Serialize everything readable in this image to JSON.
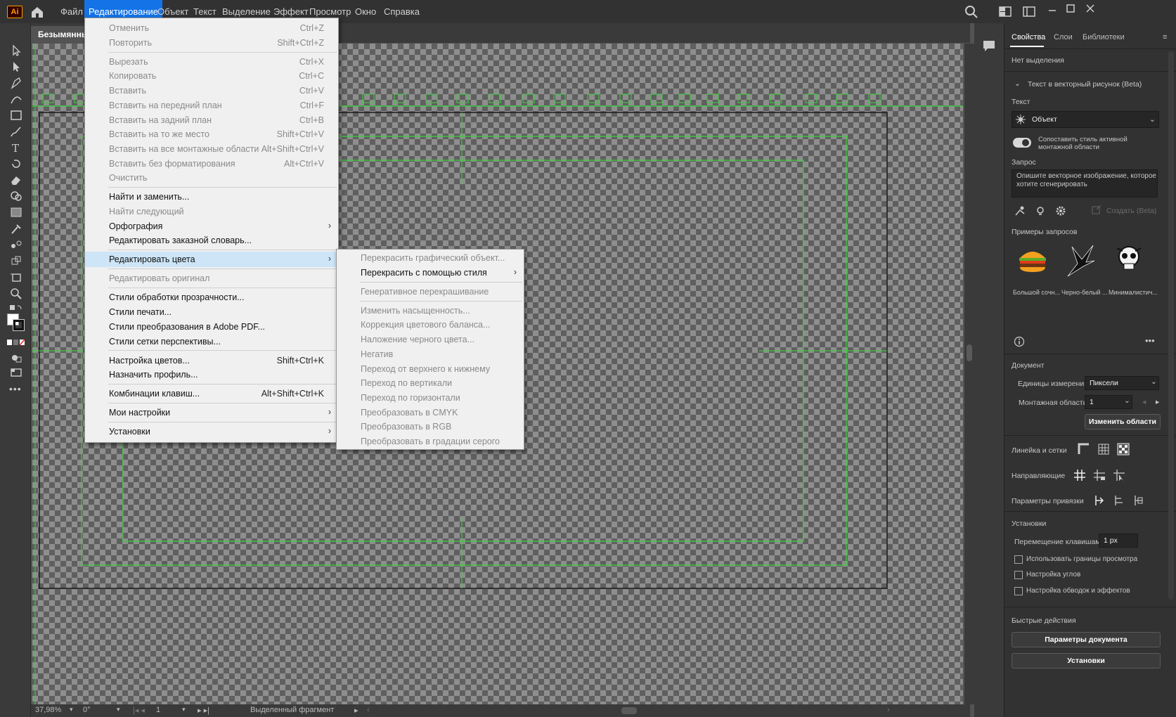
{
  "app": {
    "logo": "Ai",
    "doc_tab": "Безымянный"
  },
  "menubar": [
    "Файл",
    "Редактирование",
    "Объект",
    "Текст",
    "Выделение",
    "Эффект",
    "Просмотр",
    "Окно",
    "Справка"
  ],
  "edit_menu": [
    {
      "label": "Отменить",
      "shortcut": "Ctrl+Z",
      "disabled": true
    },
    {
      "label": "Повторить",
      "shortcut": "Shift+Ctrl+Z",
      "disabled": true
    },
    {
      "sep": true
    },
    {
      "label": "Вырезать",
      "shortcut": "Ctrl+X",
      "disabled": true
    },
    {
      "label": "Копировать",
      "shortcut": "Ctrl+C",
      "disabled": true
    },
    {
      "label": "Вставить",
      "shortcut": "Ctrl+V",
      "disabled": true
    },
    {
      "label": "Вставить на передний план",
      "shortcut": "Ctrl+F",
      "disabled": true
    },
    {
      "label": "Вставить на задний план",
      "shortcut": "Ctrl+B",
      "disabled": true
    },
    {
      "label": "Вставить на то же место",
      "shortcut": "Shift+Ctrl+V",
      "disabled": true
    },
    {
      "label": "Вставить на все монтажные области",
      "shortcut": "Alt+Shift+Ctrl+V",
      "disabled": true
    },
    {
      "label": "Вставить без форматирования",
      "shortcut": "Alt+Ctrl+V",
      "disabled": true
    },
    {
      "label": "Очистить",
      "shortcut": "",
      "disabled": true
    },
    {
      "sep": true
    },
    {
      "label": "Найти и заменить...",
      "shortcut": ""
    },
    {
      "label": "Найти следующий",
      "shortcut": "",
      "disabled": true
    },
    {
      "label": "Орфография",
      "shortcut": "",
      "submenu": true
    },
    {
      "label": "Редактировать заказной словарь...",
      "shortcut": ""
    },
    {
      "sep": true
    },
    {
      "label": "Редактировать цвета",
      "shortcut": "",
      "submenu": true,
      "highlight": true
    },
    {
      "sep": true
    },
    {
      "label": "Редактировать оригинал",
      "shortcut": "",
      "disabled": true
    },
    {
      "sep": true
    },
    {
      "label": "Стили обработки прозрачности...",
      "shortcut": ""
    },
    {
      "label": "Стили печати...",
      "shortcut": ""
    },
    {
      "label": "Стили преобразования в Adobe PDF...",
      "shortcut": ""
    },
    {
      "label": "Стили сетки перспективы...",
      "shortcut": ""
    },
    {
      "sep": true
    },
    {
      "label": "Настройка цветов...",
      "shortcut": "Shift+Ctrl+K"
    },
    {
      "label": "Назначить профиль...",
      "shortcut": ""
    },
    {
      "sep": true
    },
    {
      "label": "Комбинации клавиш...",
      "shortcut": "Alt+Shift+Ctrl+K"
    },
    {
      "sep": true
    },
    {
      "label": "Мои настройки",
      "shortcut": "",
      "submenu": true
    },
    {
      "sep": true
    },
    {
      "label": "Установки",
      "shortcut": "",
      "submenu": true
    }
  ],
  "colors_submenu": [
    {
      "label": "Перекрасить графический объект...",
      "disabled": true
    },
    {
      "label": "Перекрасить с помощью стиля",
      "submenu": true
    },
    {
      "sep": true
    },
    {
      "label": "Генеративное перекрашивание",
      "disabled": true
    },
    {
      "sep": true
    },
    {
      "label": "Изменить насыщенность...",
      "disabled": true
    },
    {
      "label": "Коррекция цветового баланса...",
      "disabled": true
    },
    {
      "label": "Наложение черного цвета...",
      "disabled": true
    },
    {
      "label": "Негатив",
      "disabled": true
    },
    {
      "label": "Переход от верхнего к нижнему",
      "disabled": true
    },
    {
      "label": "Переход по вертикали",
      "disabled": true
    },
    {
      "label": "Переход по горизонтали",
      "disabled": true
    },
    {
      "label": "Преобразовать в CMYK",
      "disabled": true
    },
    {
      "label": "Преобразовать в RGB",
      "disabled": true
    },
    {
      "label": "Преобразовать в градации серого",
      "disabled": true
    }
  ],
  "status": {
    "zoom": "37,98%",
    "rotation": "0°",
    "artboard": "1",
    "mode": "Выделенный фрагмент"
  },
  "panel": {
    "tabs": [
      "Свойства",
      "Слои",
      "Библиотеки"
    ],
    "no_selection": "Нет выделения",
    "section_t2v": "Текст в векторный рисунок (Beta)",
    "type_label": "Текст",
    "type_value": "Объект",
    "match_style": "Сопоставить стиль активной монтажной области",
    "prompt_label": "Запрос",
    "prompt_placeholder": "Опишите векторное изображение, которое хотите сгенерировать",
    "generate_btn": "Создать (Beta)",
    "examples_label": "Примеры запросов",
    "examples": [
      "Большой сочн...",
      "Черно-белый ...",
      "Минималистич..."
    ],
    "document_label": "Документ",
    "units_label": "Единицы измерения:",
    "units_value": "Пиксели",
    "artboard_label": "Монтажная область:",
    "artboard_value": "1",
    "edit_artboards_btn": "Изменить области",
    "rulers_label": "Линейка и сетки",
    "guides_label": "Направляющие",
    "snap_label": "Параметры привязки",
    "prefs_label": "Установки",
    "keyboard_inc_label": "Перемещение клавишами:",
    "keyboard_inc_value": "1 px",
    "chk_preview_bounds": "Использовать границы просмотра",
    "chk_corners": "Настройка углов",
    "chk_strokes": "Настройка обводок и эффектов",
    "quick_actions_label": "Быстрые действия",
    "doc_setup_btn": "Параметры документа",
    "prefs_btn": "Установки"
  }
}
